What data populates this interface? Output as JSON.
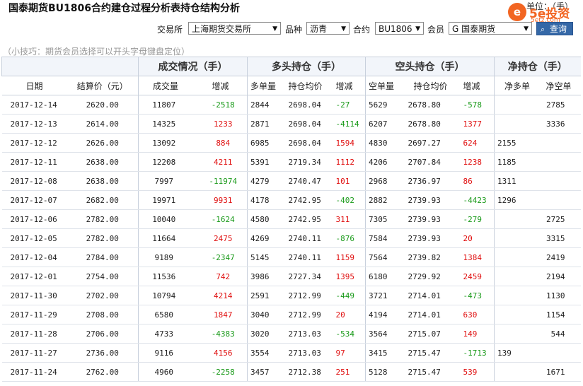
{
  "title": "国泰期货BU1806合约建仓过程分析表持仓结构分析",
  "unit": "单位：（手）",
  "logo": {
    "mark": "e",
    "brand": "5e投资",
    "sub": "5etz.com"
  },
  "colors": {
    "up": "#e01010",
    "down": "#1a9a1a",
    "header_bg": "#f2f5fa",
    "button": "#3568a7",
    "logo": "#f26522"
  },
  "filters": {
    "exchange_label": "交易所",
    "exchange_value": "上海期货交易所",
    "variety_label": "品种",
    "variety_value": "沥青",
    "contract_label": "合约",
    "contract_value": "BU1806",
    "member_label": "会员",
    "member_value": "G 国泰期货",
    "query_label": "查询"
  },
  "tip": "（小技巧：期货会员选择可以开头字母键盘定位）",
  "groups": [
    "成交情况（手）",
    "多头持仓（手）",
    "空头持仓（手）",
    "净持仓（手）"
  ],
  "columns": [
    "日期",
    "结算价（元）",
    "成交量",
    "增减",
    "多单量",
    "持仓均价",
    "增减",
    "空单量",
    "持仓均价",
    "增减",
    "净多单",
    "净空单"
  ],
  "rows": [
    {
      "date": "2017-12-14",
      "settle": "2620.00",
      "vol": "11807",
      "vol_chg": "-2518",
      "long": "2844",
      "long_avg": "2698.04",
      "long_chg": "-27",
      "short": "5629",
      "short_avg": "2678.80",
      "short_chg": "-578",
      "net_long": "",
      "net_short": "2785"
    },
    {
      "date": "2017-12-13",
      "settle": "2614.00",
      "vol": "14325",
      "vol_chg": "1233",
      "long": "2871",
      "long_avg": "2698.04",
      "long_chg": "-4114",
      "short": "6207",
      "short_avg": "2678.80",
      "short_chg": "1377",
      "net_long": "",
      "net_short": "3336"
    },
    {
      "date": "2017-12-12",
      "settle": "2626.00",
      "vol": "13092",
      "vol_chg": "884",
      "long": "6985",
      "long_avg": "2698.04",
      "long_chg": "1594",
      "short": "4830",
      "short_avg": "2697.27",
      "short_chg": "624",
      "net_long": "2155",
      "net_short": ""
    },
    {
      "date": "2017-12-11",
      "settle": "2638.00",
      "vol": "12208",
      "vol_chg": "4211",
      "long": "5391",
      "long_avg": "2719.34",
      "long_chg": "1112",
      "short": "4206",
      "short_avg": "2707.84",
      "short_chg": "1238",
      "net_long": "1185",
      "net_short": ""
    },
    {
      "date": "2017-12-08",
      "settle": "2638.00",
      "vol": "7997",
      "vol_chg": "-11974",
      "long": "4279",
      "long_avg": "2740.47",
      "long_chg": "101",
      "short": "2968",
      "short_avg": "2736.97",
      "short_chg": "86",
      "net_long": "1311",
      "net_short": ""
    },
    {
      "date": "2017-12-07",
      "settle": "2682.00",
      "vol": "19971",
      "vol_chg": "9931",
      "long": "4178",
      "long_avg": "2742.95",
      "long_chg": "-402",
      "short": "2882",
      "short_avg": "2739.93",
      "short_chg": "-4423",
      "net_long": "1296",
      "net_short": ""
    },
    {
      "date": "2017-12-06",
      "settle": "2782.00",
      "vol": "10040",
      "vol_chg": "-1624",
      "long": "4580",
      "long_avg": "2742.95",
      "long_chg": "311",
      "short": "7305",
      "short_avg": "2739.93",
      "short_chg": "-279",
      "net_long": "",
      "net_short": "2725"
    },
    {
      "date": "2017-12-05",
      "settle": "2782.00",
      "vol": "11664",
      "vol_chg": "2475",
      "long": "4269",
      "long_avg": "2740.11",
      "long_chg": "-876",
      "short": "7584",
      "short_avg": "2739.93",
      "short_chg": "20",
      "net_long": "",
      "net_short": "3315"
    },
    {
      "date": "2017-12-04",
      "settle": "2784.00",
      "vol": "9189",
      "vol_chg": "-2347",
      "long": "5145",
      "long_avg": "2740.11",
      "long_chg": "1159",
      "short": "7564",
      "short_avg": "2739.82",
      "short_chg": "1384",
      "net_long": "",
      "net_short": "2419"
    },
    {
      "date": "2017-12-01",
      "settle": "2754.00",
      "vol": "11536",
      "vol_chg": "742",
      "long": "3986",
      "long_avg": "2727.34",
      "long_chg": "1395",
      "short": "6180",
      "short_avg": "2729.92",
      "short_chg": "2459",
      "net_long": "",
      "net_short": "2194"
    },
    {
      "date": "2017-11-30",
      "settle": "2702.00",
      "vol": "10794",
      "vol_chg": "4214",
      "long": "2591",
      "long_avg": "2712.99",
      "long_chg": "-449",
      "short": "3721",
      "short_avg": "2714.01",
      "short_chg": "-473",
      "net_long": "",
      "net_short": "1130"
    },
    {
      "date": "2017-11-29",
      "settle": "2708.00",
      "vol": "6580",
      "vol_chg": "1847",
      "long": "3040",
      "long_avg": "2712.99",
      "long_chg": "20",
      "short": "4194",
      "short_avg": "2714.01",
      "short_chg": "630",
      "net_long": "",
      "net_short": "1154"
    },
    {
      "date": "2017-11-28",
      "settle": "2706.00",
      "vol": "4733",
      "vol_chg": "-4383",
      "long": "3020",
      "long_avg": "2713.03",
      "long_chg": "-534",
      "short": "3564",
      "short_avg": "2715.07",
      "short_chg": "149",
      "net_long": "",
      "net_short": "544"
    },
    {
      "date": "2017-11-27",
      "settle": "2736.00",
      "vol": "9116",
      "vol_chg": "4156",
      "long": "3554",
      "long_avg": "2713.03",
      "long_chg": "97",
      "short": "3415",
      "short_avg": "2715.47",
      "short_chg": "-1713",
      "net_long": "139",
      "net_short": ""
    },
    {
      "date": "2017-11-24",
      "settle": "2762.00",
      "vol": "4960",
      "vol_chg": "-2258",
      "long": "3457",
      "long_avg": "2712.38",
      "long_chg": "251",
      "short": "5128",
      "short_avg": "2715.47",
      "short_chg": "539",
      "net_long": "",
      "net_short": "1671"
    }
  ]
}
